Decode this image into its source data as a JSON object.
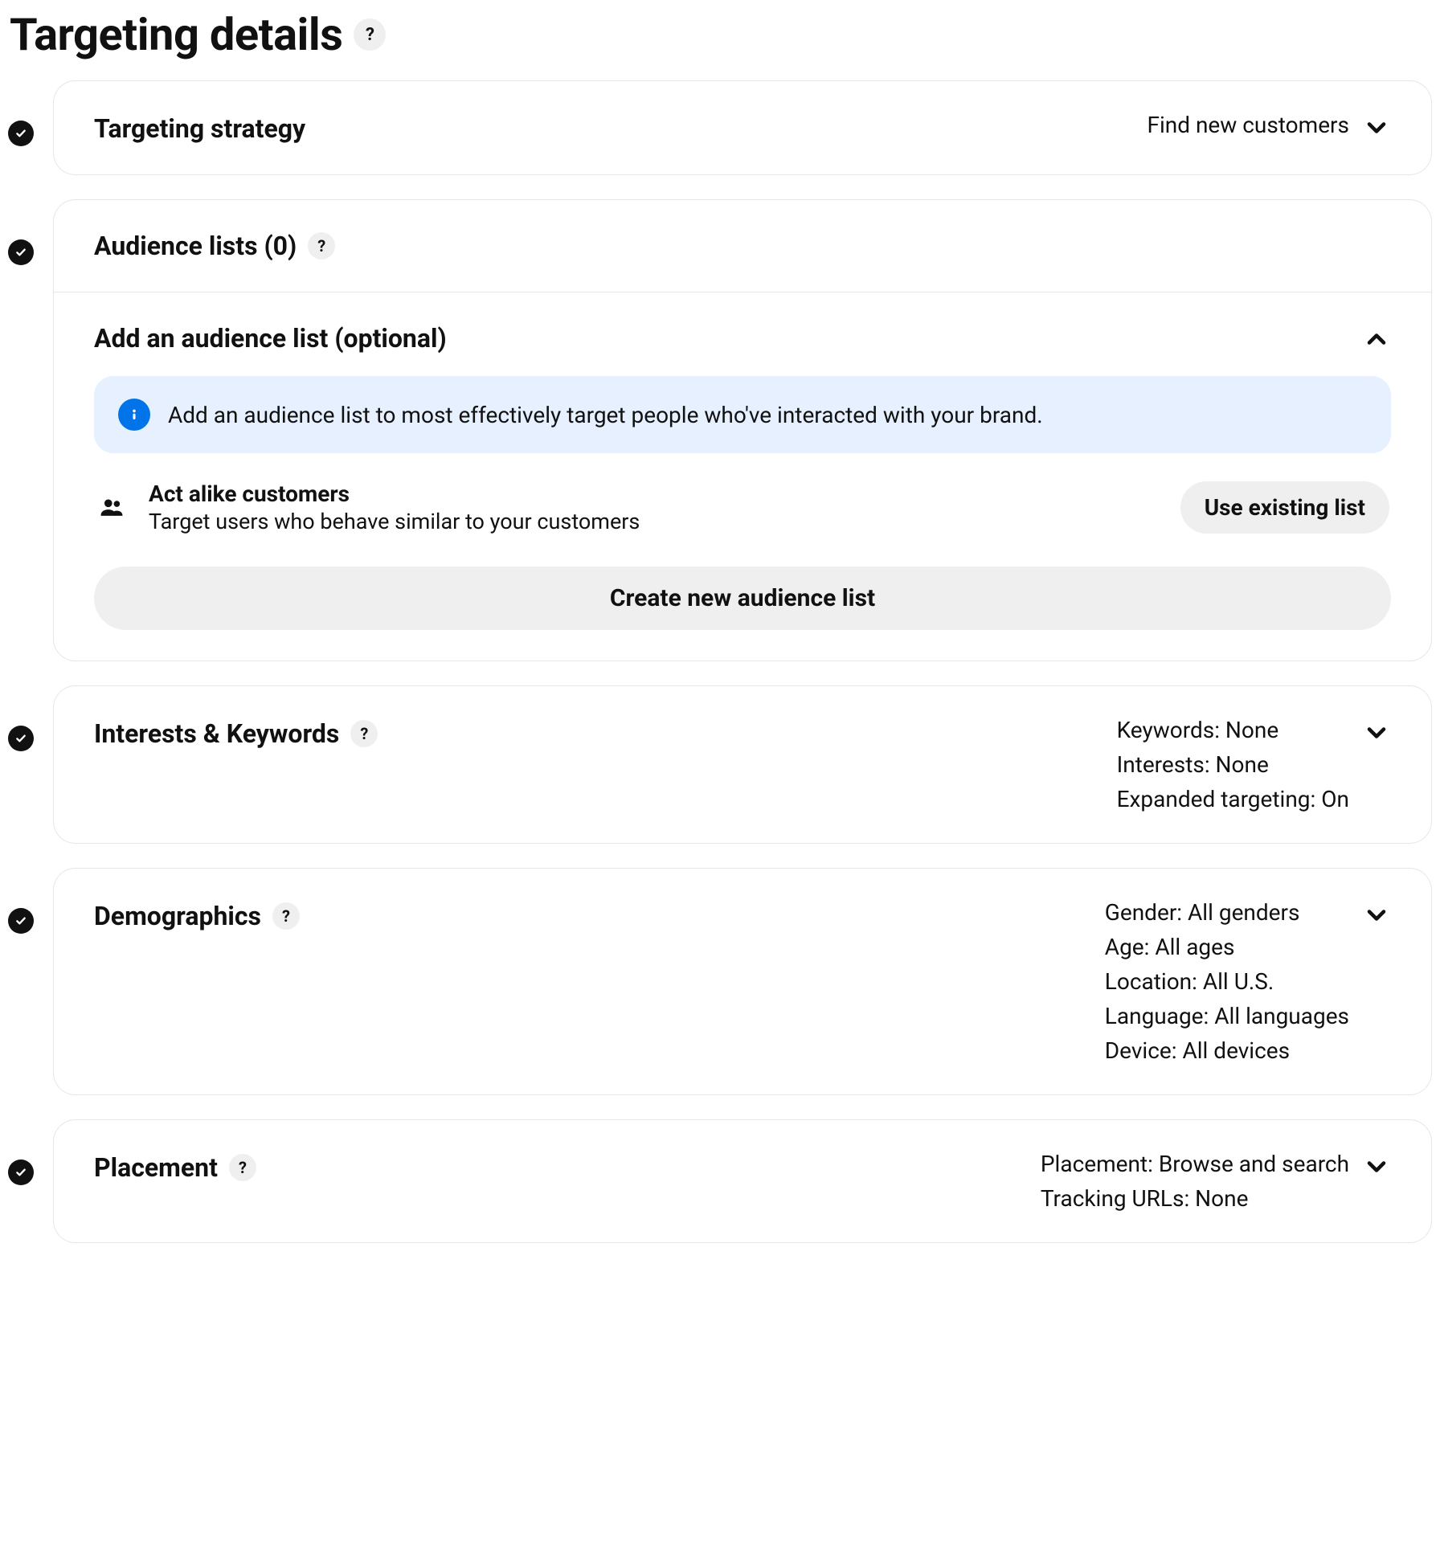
{
  "page": {
    "title": "Targeting details"
  },
  "help_glyph": "?",
  "cards": {
    "strategy": {
      "title": "Targeting strategy",
      "summary": "Find new customers"
    },
    "audience": {
      "title": "Audience lists (0)",
      "subsection_title": "Add an audience list (optional)",
      "info": "Add an audience list to most effectively target people who've interacted with your brand.",
      "actalike": {
        "title": "Act alike customers",
        "subtitle": "Target users who behave similar to your customers",
        "button": "Use existing list"
      },
      "create_button": "Create new audience list"
    },
    "interests": {
      "title": "Interests & Keywords",
      "lines": {
        "keywords": "Keywords: None",
        "interests": "Interests: None",
        "expanded": "Expanded targeting: On"
      }
    },
    "demographics": {
      "title": "Demographics",
      "lines": {
        "gender": "Gender: All genders",
        "age": "Age: All ages",
        "location": "Location: All U.S.",
        "language": "Language: All languages",
        "device": "Device: All devices"
      }
    },
    "placement": {
      "title": "Placement",
      "lines": {
        "placement": "Placement: Browse and search",
        "tracking": "Tracking URLs: None"
      }
    }
  }
}
